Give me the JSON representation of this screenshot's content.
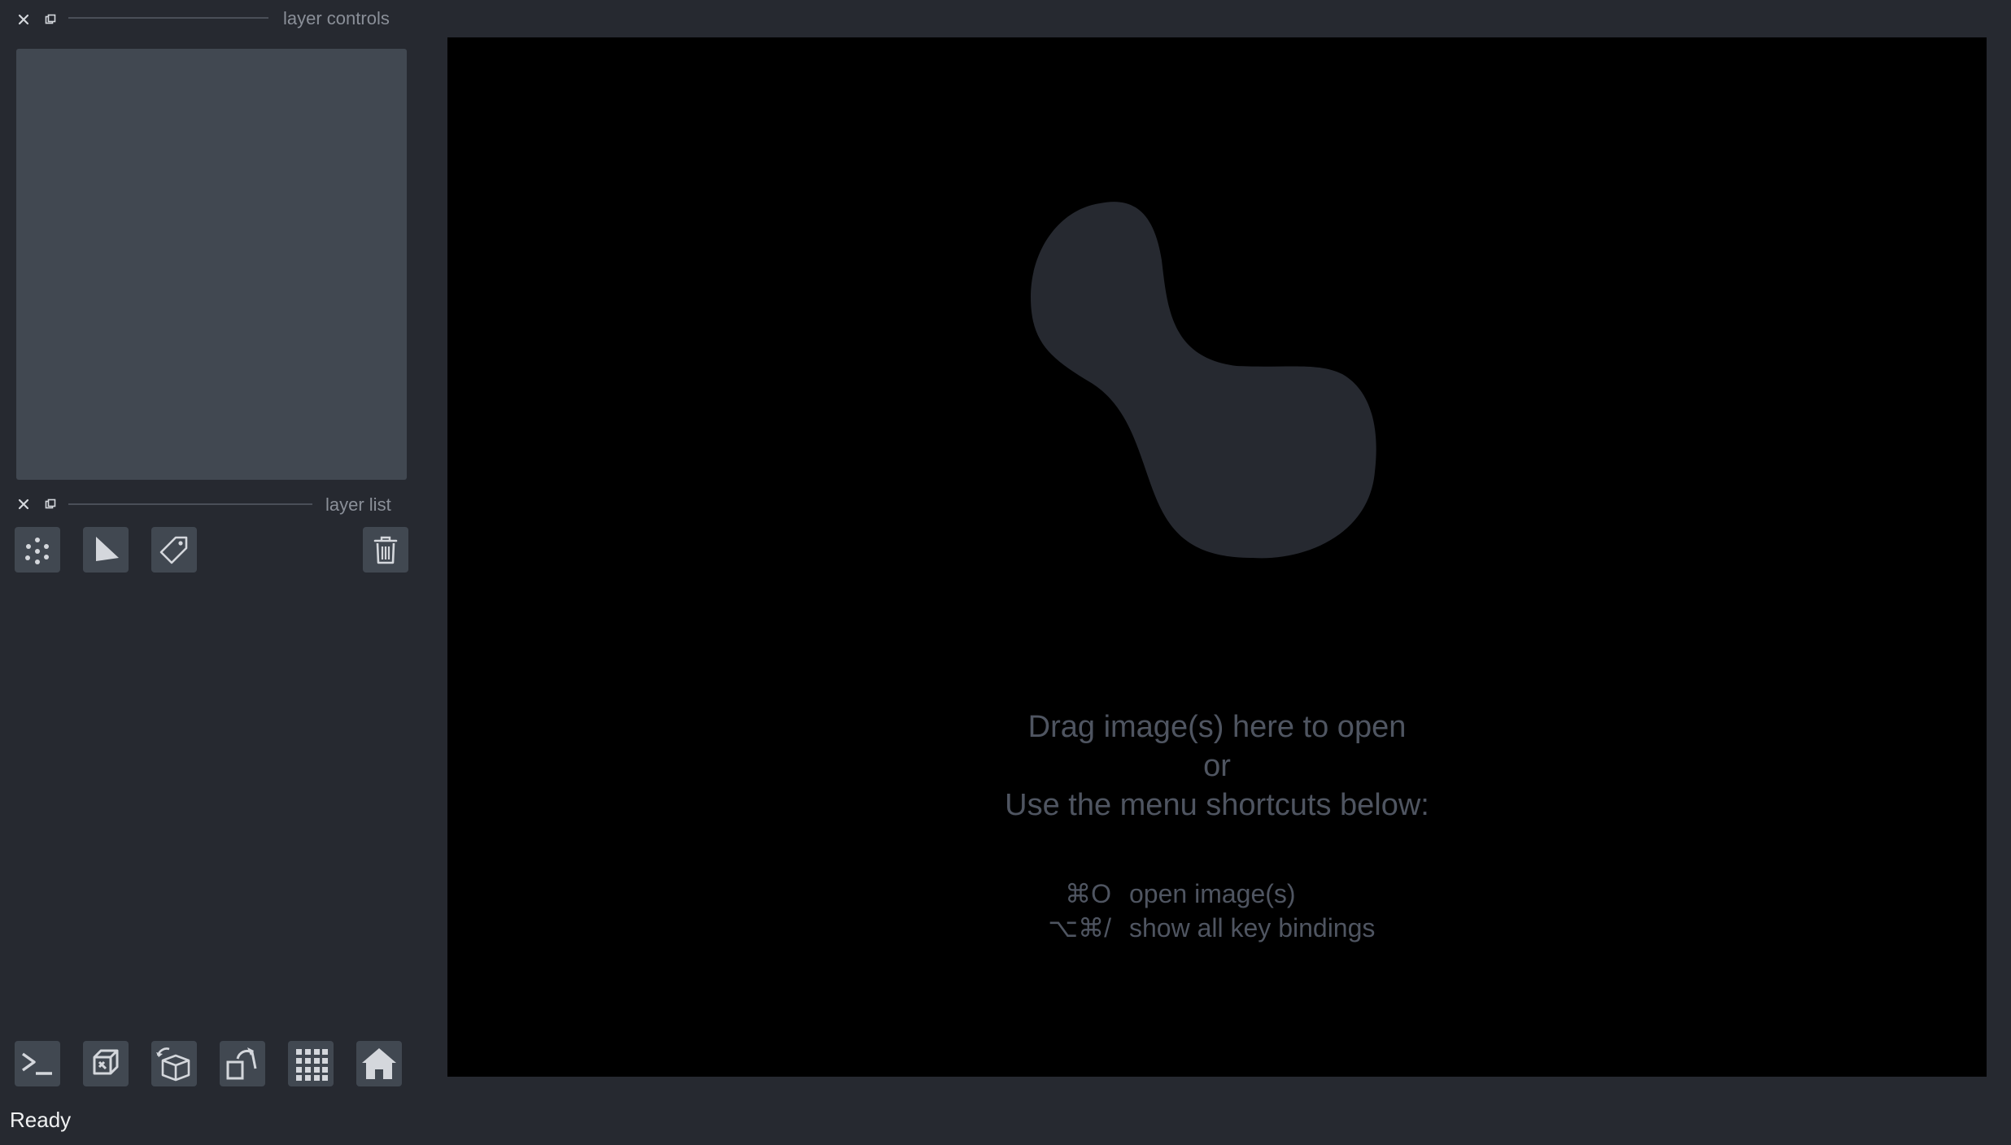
{
  "layer_controls": {
    "title": "layer controls"
  },
  "layer_list": {
    "title": "layer list"
  },
  "layer_buttons": {
    "new_points": "points-icon",
    "new_shapes": "shapes-icon",
    "new_labels": "labels-icon",
    "delete": "trash-icon"
  },
  "viewer_buttons": [
    "console-icon",
    "ndisplay-icon",
    "roll-dims-icon",
    "transpose-icon",
    "grid-icon",
    "home-icon"
  ],
  "welcome": {
    "line1": "Drag image(s) here to open",
    "line2": "or",
    "line3": "Use the menu shortcuts below:",
    "shortcuts": [
      {
        "key": "⌘O",
        "desc": "open image(s)"
      },
      {
        "key": "⌥⌘/",
        "desc": "show all key bindings"
      }
    ]
  },
  "status": "Ready",
  "colors": {
    "background": "#262930",
    "panel": "#414851",
    "canvas": "#000000",
    "logo": "#262930",
    "welcome_text": "#4f5561"
  }
}
